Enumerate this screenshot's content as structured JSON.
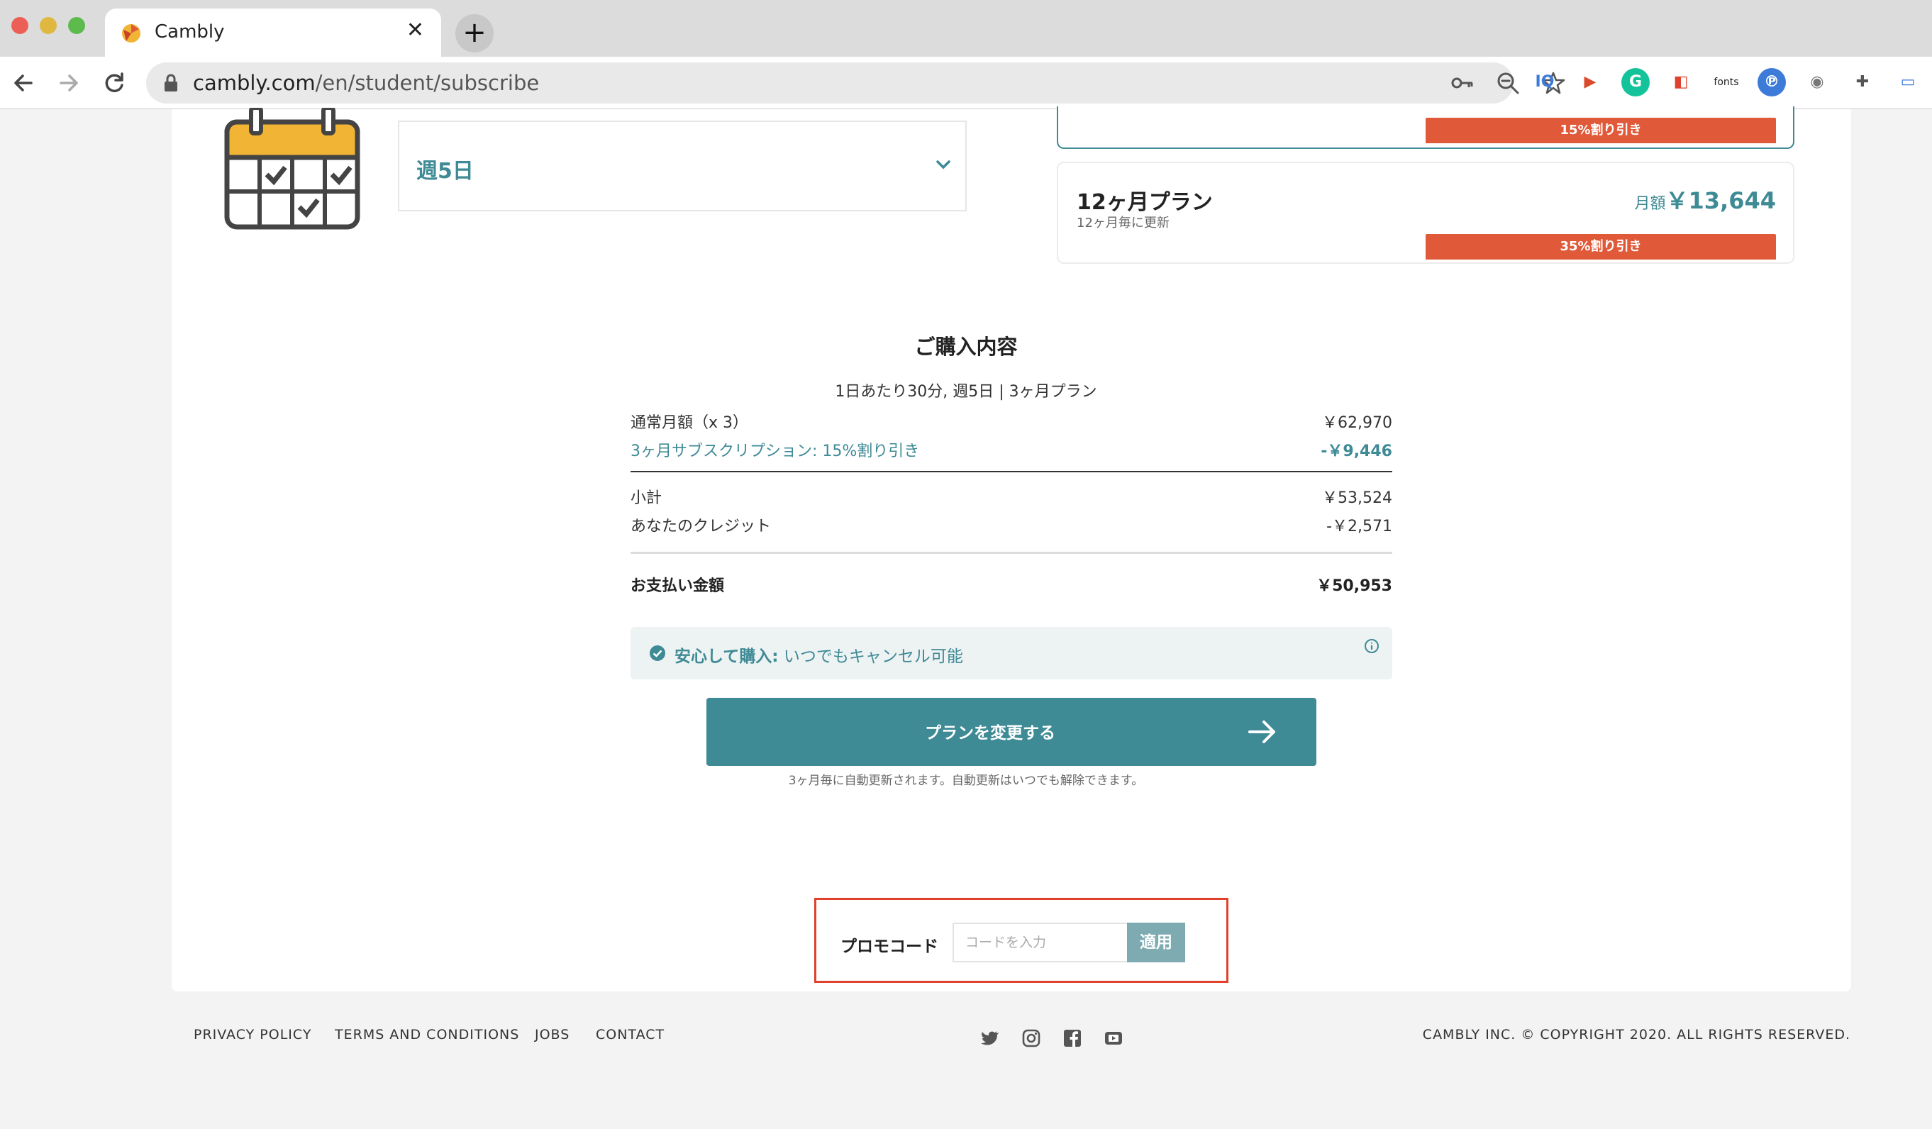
{
  "browser": {
    "tab_title": "Cambly",
    "tab_close": "✕",
    "new_tab": "+",
    "url_host": "cambly.com",
    "url_path": "/en/student/subscribe",
    "extensions": [
      "IQ",
      "▶",
      "G",
      "◧",
      "fonts",
      "℗",
      "◉",
      "✚",
      "▭"
    ]
  },
  "subscribe": {
    "frequency_value": "週5日",
    "plans": [
      {
        "discount": "15%割り引き"
      },
      {
        "name": "12ヶ月プラン",
        "renewal": "12ヶ月毎に更新",
        "price_unit": "月額",
        "price": "￥13,644",
        "discount": "35%割り引き"
      }
    ]
  },
  "summary": {
    "title": "ご購入内容",
    "subtitle": "1日あたり30分, 週5日 | 3ヶ月プラン",
    "rows": [
      {
        "label": "通常月額（x 3）",
        "value": "￥62,970"
      },
      {
        "label": "3ヶ月サブスクリプション: 15%割り引き",
        "value": "-￥9,446"
      },
      {
        "label": "小計",
        "value": "￥53,524"
      },
      {
        "label": "あなたのクレジット",
        "value": "-￥2,571"
      },
      {
        "label": "お支払い金額",
        "value": "￥50,953"
      }
    ],
    "guarantee_bold": "安心して購入:",
    "guarantee_text": " いつでもキャンセル可能",
    "cta_label": "プランを変更する",
    "renew_note": "3ヶ月毎に自動更新されます。自動更新はいつでも解除できます。"
  },
  "promo": {
    "label": "プロモコード",
    "placeholder": "コードを入力",
    "apply_label": "適用"
  },
  "footer": {
    "links": [
      "PRIVACY POLICY",
      "TERMS AND CONDITIONS",
      "JOBS",
      "CONTACT"
    ],
    "social": [
      "twitter",
      "instagram",
      "facebook",
      "youtube"
    ],
    "copyright": "CAMBLY INC. © COPYRIGHT 2020. ALL RIGHTS RESERVED."
  },
  "colors": {
    "brand": "#3e8a95",
    "discount": "#e05a3a",
    "promo_highlight": "#e0412c"
  }
}
